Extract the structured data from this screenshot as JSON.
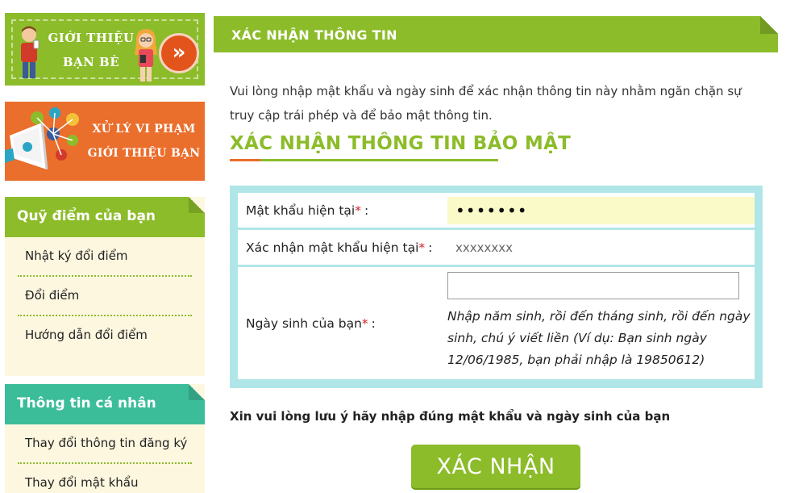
{
  "banners": {
    "refer_friends": {
      "line1": "GIỚI THIỆU",
      "line2": "BẠN BÈ",
      "arrow": "»"
    },
    "violations": {
      "line1": "XỬ LÝ VI PHẠM",
      "line2": "GIỚI THIỆU BẠN"
    }
  },
  "sidebar": {
    "points": {
      "title": "Quỹ điểm của bạn",
      "items": [
        {
          "label": "Nhật ký đổi điểm"
        },
        {
          "label": "Đổi điểm"
        },
        {
          "label": "Hướng dẫn đổi điểm"
        }
      ]
    },
    "profile": {
      "title": "Thông tin cá nhân",
      "items": [
        {
          "label": "Thay đổi thông tin đăng ký"
        },
        {
          "label": "Thay đổi mật khẩu"
        }
      ]
    }
  },
  "main": {
    "header": "XÁC NHẬN THÔNG TIN",
    "intro": "Vui lòng nhập mật khẩu và ngày sinh để xác nhận thông tin này nhằm ngăn chặn sự truy cập trái phép và để bảo mật thông tin.",
    "section_title": "XÁC NHẬN THÔNG TIN BẢO MẬT",
    "form": {
      "password": {
        "label": "Mật khẩu hiện tại",
        "star": "*",
        "suffix": " :",
        "value": "•••••••"
      },
      "confirm_password": {
        "label": "Xác nhận mật khẩu hiện tại",
        "star": "*",
        "suffix": " :",
        "placeholder": "xxxxxxxx"
      },
      "dob": {
        "label": "Ngày sinh của bạn",
        "star": "*",
        "suffix": " :",
        "value": "",
        "hint": "Nhập năm sinh, rồi đến tháng sinh, rồi đến ngày sinh, chú ý viết liền (Ví dụ: Bạn sinh ngày 12/06/1985, bạn phải nhập là 19850612)"
      }
    },
    "note": "Xin vui lòng lưu ý hãy nhập đúng mật khẩu và ngày sinh của bạn",
    "submit_label": "XÁC NHẬN"
  },
  "colors": {
    "green": "#8cbc2a",
    "orange": "#ea6e2c",
    "teal": "#3bbd9a",
    "form_bg": "#b0e6e8",
    "sidebar_bg": "#fdf7e0",
    "required": "#d0202a"
  }
}
